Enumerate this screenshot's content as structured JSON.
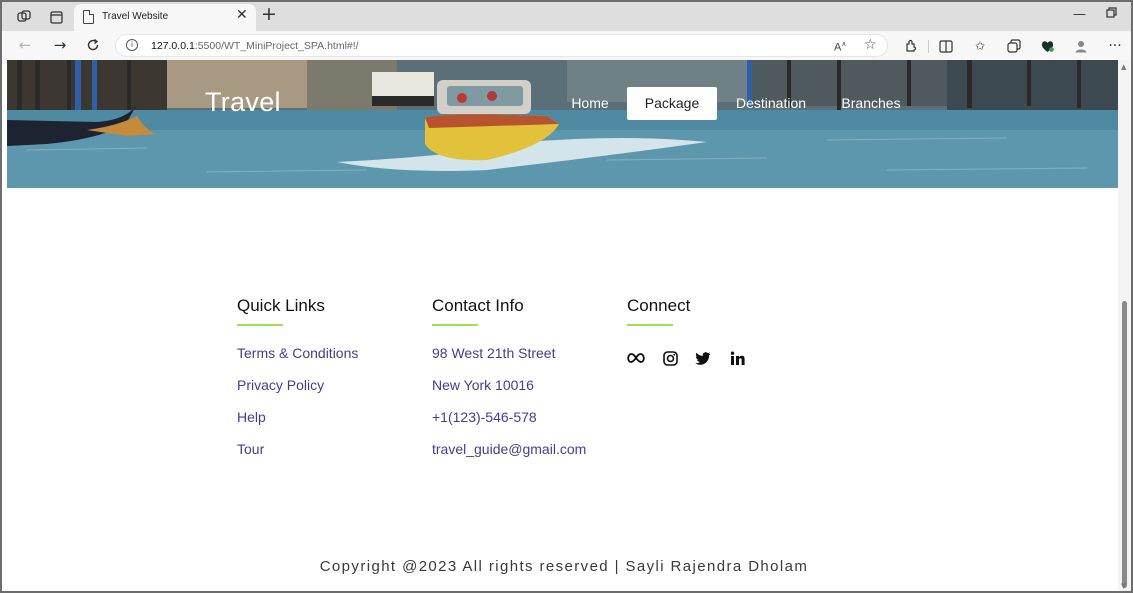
{
  "browser": {
    "tab_title": "Travel Website",
    "url": "127.0.0.1:5500/WT_MiniProject_SPA.html#!/",
    "url_host": "127.0.0.1",
    "url_rest": ":5500/WT_MiniProject_SPA.html#!/"
  },
  "header": {
    "brand": "Travel",
    "nav": [
      {
        "label": "Home",
        "active": false
      },
      {
        "label": "Package",
        "active": true
      },
      {
        "label": "Destination",
        "active": false
      },
      {
        "label": "Branches",
        "active": false
      }
    ]
  },
  "footer": {
    "quick_links": {
      "title": "Quick Links",
      "items": [
        "Terms & Conditions",
        "Privacy Policy",
        "Help",
        "Tour"
      ]
    },
    "contact": {
      "title": "Contact Info",
      "items": [
        "98 West 21th Street",
        "New York 10016",
        "+1(123)-546-578",
        "travel_guide@gmail.com"
      ]
    },
    "connect": {
      "title": "Connect",
      "icons": [
        "meta-icon",
        "instagram-icon",
        "twitter-icon",
        "linkedin-icon"
      ]
    },
    "copyright": "Copyright @2023 All rights reserved | Sayli Rajendra Dholam"
  },
  "colors": {
    "link": "#41408f",
    "accent_underline": "#a3e04f",
    "active_nav_bg": "#ffffff"
  }
}
